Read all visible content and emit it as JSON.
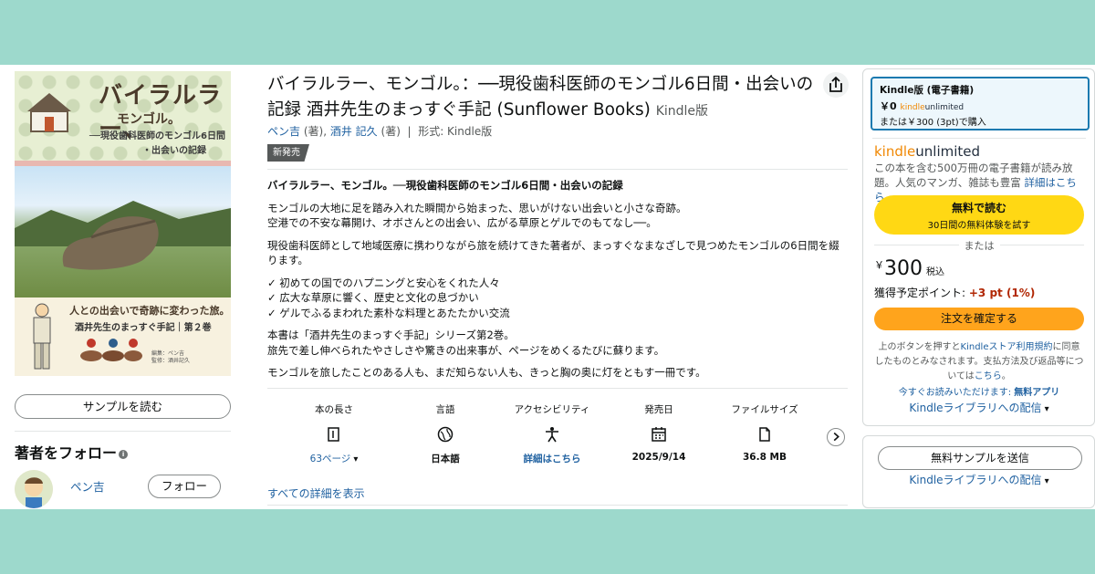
{
  "cover": {
    "title": "バイラルラー、",
    "title2": "モンゴル。",
    "subtitle": "──現役歯科医師のモンゴル6日間",
    "subtitle2": "・出会いの記録",
    "tagline": "人との出会いで奇跡に変わった旅。",
    "series": "酒井先生のまっすぐ手記｜第２巻",
    "editor": "編集：ペン吉",
    "supervisor": "監修：酒井記久"
  },
  "left": {
    "sample_button": "サンプルを読む",
    "follow_title": "著者をフォロー",
    "info_icon": "i",
    "author_name": "ペン吉",
    "follow_button": "フォロー"
  },
  "product": {
    "title": "バイラルラー、モンゴル。：──現役歯科医師のモンゴル6日間・出会いの記録 酒井先生のまっすぐ手記 (Sunflower Books)",
    "format_suffix": "Kindle版",
    "author1": "ペン吉",
    "author1_role": "(著),",
    "author2": "酒井 記久",
    "author2_role": "(著)",
    "format_label": "形式: Kindle版",
    "badge": "新発売"
  },
  "description": {
    "heading": "バイラルラー、モンゴル。──現役歯科医師のモンゴル6日間・出会いの記録",
    "p1_line1": "モンゴルの大地に足を踏み入れた瞬間から始まった、思いがけない出会いと小さな奇跡。",
    "p1_line2": "空港での不安な幕開け、オボさんとの出会い、広がる草原とゲルでのもてなし──。",
    "p2": "現役歯科医師として地域医療に携わりながら旅を続けてきた著者が、まっすぐなまなざしで見つめたモンゴルの6日間を綴ります。",
    "bullets": [
      "✓ 初めての国でのハプニングと安心をくれた人々",
      "✓ 広大な草原に響く、歴史と文化の息づかい",
      "✓ ゲルでふるまわれた素朴な料理とあたたかい交流"
    ],
    "p3_line1": "本書は「酒井先生のまっすぐ手記」シリーズ第2巻。",
    "p3_line2": "旅先で差し伸べられたやさしさや驚きの出来事が、ページをめくるたびに蘇ります。",
    "p4": "モンゴルを旅したことのある人も、まだ知らない人も、きっと胸の奥に灯をともす一冊です。"
  },
  "specs": [
    {
      "label": "本の長さ",
      "value": "63ページ",
      "icon": "book-length-icon"
    },
    {
      "label": "言語",
      "value": "日本語",
      "icon": "globe-icon"
    },
    {
      "label": "アクセシビリティ",
      "value": "詳細はこちら",
      "icon": "accessibility-icon"
    },
    {
      "label": "発売日",
      "value": "2025/9/14",
      "icon": "calendar-icon"
    },
    {
      "label": "ファイルサイズ",
      "value": "36.8 MB",
      "icon": "file-icon"
    }
  ],
  "all_details": "すべての詳細を表示",
  "buybox": {
    "selected_title": "Kindle版 (電子書籍)",
    "selected_price": "￥0",
    "ku_kindle": "kindle",
    "ku_unlimited": "unlimited",
    "selected_or": "または￥300 (3pt)で購入",
    "ku_desc": "この本を含む500万冊の電子書籍が読み放題。人気のマンガ、雑誌も豊富",
    "ku_link": "詳細はこちら",
    "free_read": "無料で読む",
    "free_trial": "30日間の無料体験を試す",
    "or": "または",
    "currency": "￥",
    "price": "300",
    "tax": "税込",
    "points_label": "獲得予定ポイント:",
    "points_value": "+3 pt (1%)",
    "confirm": "注文を確定する",
    "fine_prefix": "上のボタンを押すと",
    "fine_link1": "Kindleストア利用規約",
    "fine_mid": "に同意したものとみなされます。支払方法及び返品等については",
    "fine_link2": "こちら",
    "fine_end": "。",
    "app_prefix": "今すぐお読みいただけます:",
    "app_link": "無料アプリ",
    "deliver": "Kindleライブラリへの配信",
    "send_sample": "無料サンプルを送信"
  }
}
